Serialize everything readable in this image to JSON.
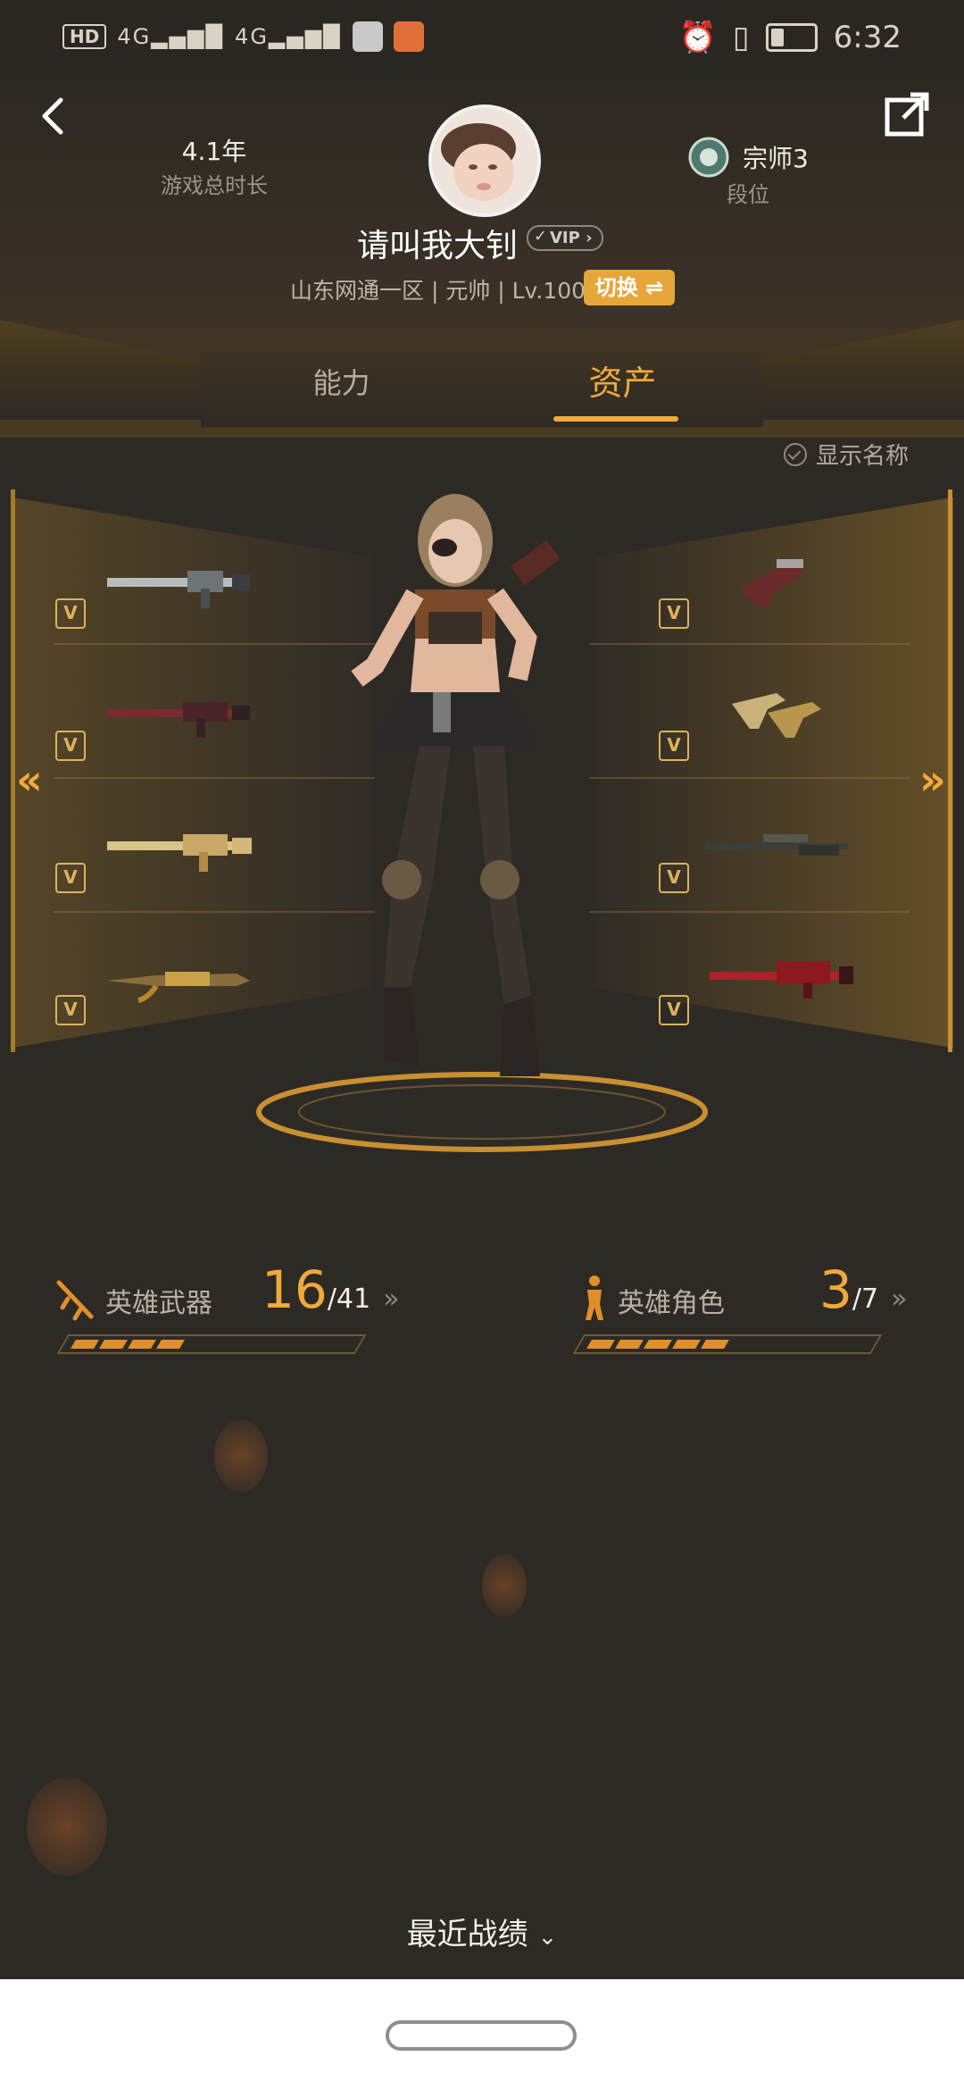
{
  "status_bar": {
    "network_badge": "HD",
    "signal_1": "4G",
    "signal_2": "4G",
    "time": "6:32"
  },
  "header": {
    "play_time_value": "4.1年",
    "play_time_label": "游戏总时长",
    "rank_value": "宗师3",
    "rank_label": "段位",
    "username": "请叫我大钊",
    "vip_label": "VIP",
    "server_info": "山东网通一区 | 元帅 | Lv.100",
    "switch_label": "切换 ⇌"
  },
  "tabs": {
    "ability": "能力",
    "assets": "资产",
    "active": "assets"
  },
  "show_names_label": "显示名称",
  "weapons": {
    "left": [
      "rifle-silver",
      "rifle-red",
      "rifle-gold",
      "rifle-ak-gold"
    ],
    "right": [
      "pistol-red",
      "dual-pistols-gold",
      "sniper-dark",
      "rifle-crimson"
    ],
    "badge": "V"
  },
  "stats": {
    "hero_weapons": {
      "label": "英雄武器",
      "owned": "16",
      "total": "/41",
      "progress": 0.39
    },
    "hero_characters": {
      "label": "英雄角色",
      "owned": "3",
      "total": "/7",
      "progress": 0.43
    }
  },
  "recent_label": "最近战绩",
  "colors": {
    "accent": "#f0a93c",
    "background": "#2d2a26",
    "switch_bg": "#e6a63a"
  }
}
